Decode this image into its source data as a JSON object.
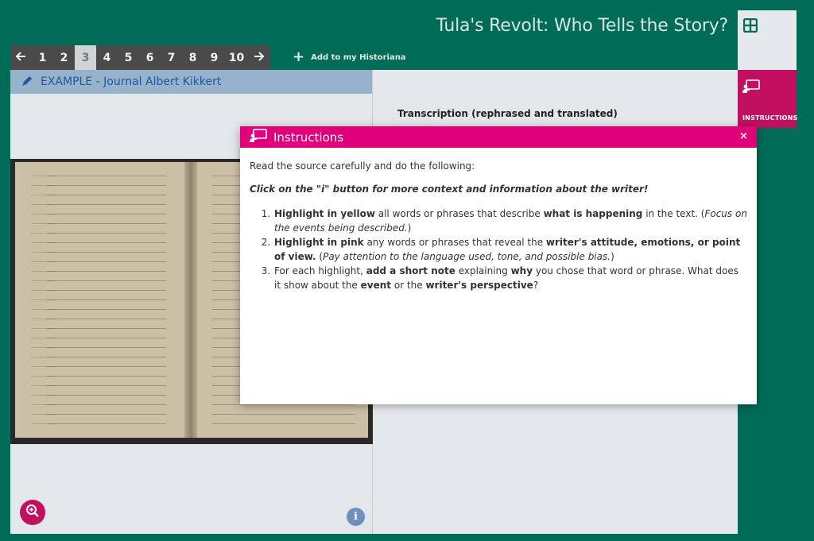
{
  "header": {
    "title": "Tula's Revolt: Who Tells the Story?"
  },
  "pager": {
    "prev_icon": "arrow-left-icon",
    "pages": [
      "1",
      "2",
      "3",
      "4",
      "5",
      "6",
      "7",
      "8",
      "9",
      "10"
    ],
    "active_page": "3",
    "next_icon": "arrow-right-icon"
  },
  "toolbar": {
    "add_label": "Add to my Historiana",
    "add_icon": "plus-icon"
  },
  "right_tabs": {
    "grid_icon": "grid-icon",
    "instructions_icon": "presentation-icon",
    "instructions_label": "INSTRUCTIONS"
  },
  "source": {
    "icon": "pencil-icon",
    "title": "EXAMPLE - Journal Albert Kikkert"
  },
  "transcription": {
    "title": "Transcription (rephrased and translated)"
  },
  "modal": {
    "title": "Instructions",
    "close": "×",
    "intro": "Read the source carefully and do the following:",
    "hint": "Click on the \"i\" button for more context and information about the writer!",
    "items": [
      {
        "a_bold": "Highlight in yellow",
        "a_text": " all words or phrases that describe ",
        "b_bold": "what is happening",
        "b_text": " in the text. (",
        "note": "Focus on the events being described.",
        "end": ")"
      },
      {
        "a_bold": "Highlight in pink",
        "a_text": " any words or phrases that reveal the ",
        "b_bold": "writer's attitude, emotions, or point of view.",
        "b_text": " (",
        "note": "Pay attention to the language used, tone, and possible bias.",
        "end": ")"
      },
      {
        "a_text": "For each highlight, ",
        "a_bold": "add a short note",
        "b_text": " explaining ",
        "b_bold": "why",
        "c_text": " you chose that word or phrase. What does it show about the ",
        "c_bold": "event",
        "d_text": " or the ",
        "d_bold": "writer's perspective",
        "end": "?"
      }
    ]
  },
  "controls": {
    "zoom_icon": "zoom-in-icon",
    "info_label": "i"
  },
  "colors": {
    "background": "#006b56",
    "accent_pink": "#e0007a",
    "tab_pink": "#c0105f",
    "source_header": "#98b2cb",
    "pager_dark": "#4a4a4a"
  }
}
